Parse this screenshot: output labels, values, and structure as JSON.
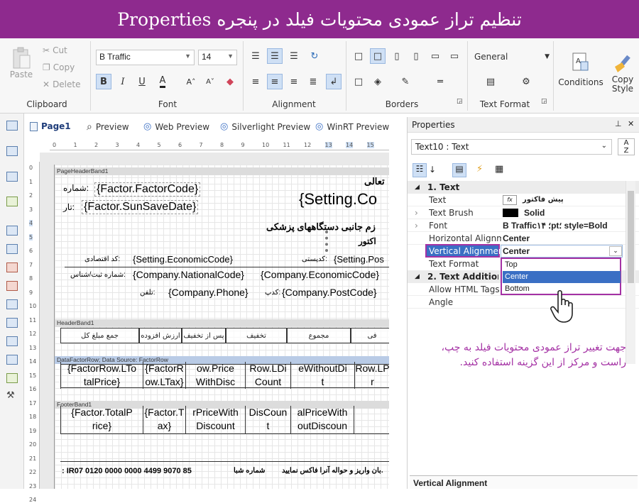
{
  "banner": {
    "title": "تنظیم تراز عمودی محتویات فیلد در پنجره Properties"
  },
  "ribbon": {
    "clipboard": {
      "paste": "Paste",
      "cut": "Cut",
      "copy": "Copy",
      "delete": "Delete",
      "label": "Clipboard"
    },
    "font": {
      "family": "B Traffic",
      "size": "14",
      "label": "Font",
      "bold": "B",
      "italic": "I",
      "underline": "U"
    },
    "alignment": {
      "label": "Alignment"
    },
    "borders": {
      "label": "Borders"
    },
    "textformat": {
      "value": "General",
      "label": "Text Format"
    },
    "conditions": "Conditions",
    "copystyle": "Copy Style"
  },
  "tabs": [
    "Page1",
    "Preview",
    "Web Preview",
    "Silverlight Preview",
    "WinRT Preview"
  ],
  "hruler_ticks": [
    "0",
    "1",
    "2",
    "3",
    "4",
    "5",
    "6",
    "7",
    "8",
    "9",
    "10",
    "11",
    "12",
    "13",
    "14",
    "15"
  ],
  "vruler_ticks": [
    "0",
    "1",
    "2",
    "3",
    "4",
    "5",
    "6",
    "7",
    "8",
    "9",
    "10",
    "11",
    "12",
    "13",
    "14",
    "15",
    "16",
    "17",
    "18",
    "19",
    "20",
    "21",
    "22",
    "23",
    "24"
  ],
  "design": {
    "page_header_band": "PageHeaderBand1",
    "header_band": "HeaderBand1",
    "data_band": "DataFactorRow; Data Source: FactorRow",
    "footer_band": "FooterBand1",
    "factor_code": "{Factor.FactorCode}",
    "factor_code_label": "شماره:",
    "sun_save_date": "{Factor.SunSaveDate}",
    "sun_save_date_label": "تار:",
    "setting_co": "{Setting.Co",
    "tali": "تعالی",
    "title1": "زم جانبی دستگاههای پزشکی",
    "title2": "اکتور",
    "economic_code": "{Setting.EconomicCode}",
    "economic_code_label": "کد اقتصادی:",
    "postal_label": "کدپستی:",
    "setting_pos": "{Setting.Pos",
    "national_code": "{Company.NationalCode}",
    "national_code_label": "شماره ثبت/شناس:",
    "company_economic": "{Company.EconomicCode}",
    "phone": "{Company.Phone}",
    "phone_label": "تلفن:",
    "postcode_label": "کدپ:",
    "postcode": "{Company.PostCode}",
    "header_cells": [
      "جمع مبلغ کل",
      "ارزش افزوده",
      "پس از تخفیف",
      "تخفیف",
      "مجموع",
      "فی"
    ],
    "data_cells": [
      "{FactorRow.LTo\ntalPrice}",
      "{FactorR\now.LTax}",
      "ow.Price\nWithDisc",
      "Row.LDi\nCount",
      "eWithoutDi\nt",
      "Row.LP\nr"
    ],
    "footer_cells": [
      "{Factor.TotalP\nrice}",
      "{Factor.T\nax}",
      "rPriceWith\nDiscount",
      "DisCoun\nt",
      "alPriceWith\noutDiscoun",
      ""
    ],
    "sheba_number": ": IR07 0120 0000 0000 4499 9070 85",
    "sheba_label": "شماره شبا",
    "sheba_note": "بان واریز و حواله آنرا فاکس نمایید."
  },
  "props": {
    "title": "Properties",
    "selector": "Text10 : Text",
    "section1": "1. Text",
    "rows": [
      {
        "name": "Text",
        "value": "پیش فاکتور"
      },
      {
        "name": "Text Brush",
        "value": "Solid"
      },
      {
        "name": "Font",
        "value": "B Traffic؛ ۱۴pt؛ style=Bold"
      },
      {
        "name": "Horizontal Alignmen",
        "value": "Center"
      },
      {
        "name": "Vertical Alignment",
        "value": "Center"
      },
      {
        "name": "Text Format",
        "value": ""
      }
    ],
    "section2": "2. Text  Additional",
    "rows2": [
      {
        "name": "Allow HTML Tags"
      },
      {
        "name": "Angle"
      }
    ],
    "dropdown_options": [
      "Top",
      "Center",
      "Bottom"
    ],
    "dropdown_selected": "Center",
    "footer": "Vertical Alignment",
    "note": "جهت تغییر تراز عمودی محتویات فیلد به چپ، راست و مرکز از این گزینه استفاده کنید."
  },
  "colors": {
    "banner": "#8e2a8e",
    "highlight": "#a431a4",
    "selection": "#3a6fc4"
  }
}
